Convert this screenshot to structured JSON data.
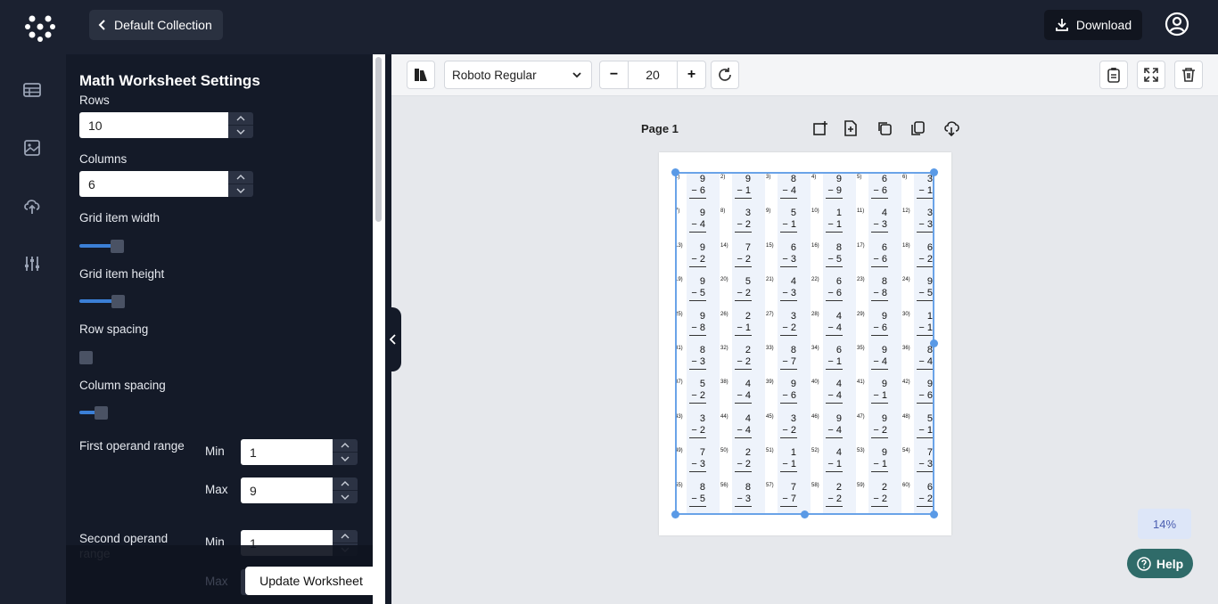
{
  "header": {
    "back_label": "Default Collection",
    "download_label": "Download"
  },
  "rail": {
    "icons": [
      "table-icon",
      "image-icon",
      "upload-cloud-icon",
      "sliders-icon"
    ]
  },
  "panel": {
    "title": "Math Worksheet Settings",
    "rows_label": "Rows",
    "rows_value": "10",
    "columns_label": "Columns",
    "columns_value": "6",
    "grid_item_width_label": "Grid item width",
    "grid_item_width_level": 0.3,
    "grid_item_height_label": "Grid item height",
    "grid_item_height_level": 0.31,
    "row_spacing_label": "Row spacing",
    "row_spacing_level": 0.0,
    "column_spacing_label": "Column spacing",
    "column_spacing_level": 0.17,
    "first_operand_label": "First operand range",
    "first_min_label": "Min",
    "first_min_value": "1",
    "first_max_label": "Max",
    "first_max_value": "9",
    "second_operand_label": "Second operand range",
    "second_min_label": "Min",
    "second_min_value": "1",
    "second_max_label": "Max",
    "update_label": "Update Worksheet"
  },
  "toolbar": {
    "font_name": "Roboto Regular",
    "font_size": "20",
    "minus_label": "−",
    "plus_label": "+"
  },
  "canvas": {
    "page_label": "Page 1",
    "zoom": "14%",
    "help_label": "Help"
  },
  "worksheet": {
    "problems": [
      [
        "1)",
        "9",
        "6"
      ],
      [
        "2)",
        "9",
        "1"
      ],
      [
        "3)",
        "8",
        "4"
      ],
      [
        "4)",
        "9",
        "9"
      ],
      [
        "5)",
        "6",
        "6"
      ],
      [
        "6)",
        "3",
        "1"
      ],
      [
        "7)",
        "9",
        "4"
      ],
      [
        "8)",
        "3",
        "2"
      ],
      [
        "9)",
        "5",
        "1"
      ],
      [
        "10)",
        "1",
        "1"
      ],
      [
        "11)",
        "4",
        "3"
      ],
      [
        "12)",
        "3",
        "3"
      ],
      [
        "13)",
        "9",
        "2"
      ],
      [
        "14)",
        "7",
        "2"
      ],
      [
        "15)",
        "6",
        "3"
      ],
      [
        "16)",
        "8",
        "5"
      ],
      [
        "17)",
        "6",
        "6"
      ],
      [
        "18)",
        "6",
        "2"
      ],
      [
        "19)",
        "9",
        "5"
      ],
      [
        "20)",
        "5",
        "2"
      ],
      [
        "21)",
        "4",
        "3"
      ],
      [
        "22)",
        "6",
        "6"
      ],
      [
        "23)",
        "8",
        "8"
      ],
      [
        "24)",
        "9",
        "5"
      ],
      [
        "25)",
        "9",
        "8"
      ],
      [
        "26)",
        "2",
        "1"
      ],
      [
        "27)",
        "3",
        "2"
      ],
      [
        "28)",
        "4",
        "4"
      ],
      [
        "29)",
        "9",
        "6"
      ],
      [
        "30)",
        "1",
        "1"
      ],
      [
        "31)",
        "8",
        "3"
      ],
      [
        "32)",
        "2",
        "2"
      ],
      [
        "33)",
        "8",
        "7"
      ],
      [
        "34)",
        "6",
        "1"
      ],
      [
        "35)",
        "9",
        "4"
      ],
      [
        "36)",
        "8",
        "4"
      ],
      [
        "37)",
        "5",
        "2"
      ],
      [
        "38)",
        "4",
        "4"
      ],
      [
        "39)",
        "9",
        "6"
      ],
      [
        "40)",
        "4",
        "4"
      ],
      [
        "41)",
        "9",
        "1"
      ],
      [
        "42)",
        "9",
        "6"
      ],
      [
        "43)",
        "3",
        "2"
      ],
      [
        "44)",
        "4",
        "4"
      ],
      [
        "45)",
        "3",
        "2"
      ],
      [
        "46)",
        "9",
        "4"
      ],
      [
        "47)",
        "9",
        "2"
      ],
      [
        "48)",
        "5",
        "1"
      ],
      [
        "49)",
        "7",
        "3"
      ],
      [
        "50)",
        "2",
        "2"
      ],
      [
        "51)",
        "1",
        "1"
      ],
      [
        "52)",
        "4",
        "1"
      ],
      [
        "53)",
        "9",
        "1"
      ],
      [
        "54)",
        "7",
        "3"
      ],
      [
        "55)",
        "8",
        "5"
      ],
      [
        "56)",
        "8",
        "3"
      ],
      [
        "57)",
        "7",
        "7"
      ],
      [
        "58)",
        "2",
        "2"
      ],
      [
        "59)",
        "2",
        "2"
      ],
      [
        "60)",
        "6",
        "2"
      ]
    ],
    "operator": "−"
  }
}
